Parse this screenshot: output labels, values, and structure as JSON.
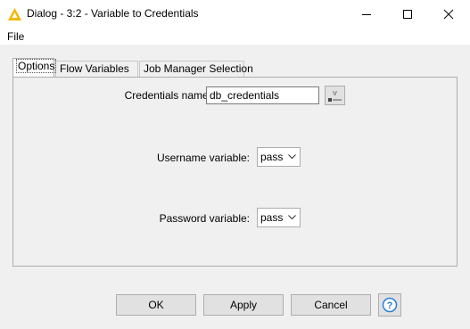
{
  "window": {
    "title": "Dialog - 3:2 - Variable to Credentials",
    "accent_color": "#f5b800"
  },
  "menu": {
    "items": [
      {
        "label": "File"
      }
    ]
  },
  "tabs": [
    {
      "label": "Options",
      "active": true
    },
    {
      "label": "Flow Variables",
      "active": false
    },
    {
      "label": "Job Manager Selection",
      "active": false
    }
  ],
  "form": {
    "credentials_label": "Credentials name:",
    "credentials_value": "db_credentials",
    "username_label": "Username variable:",
    "username_value": "pass",
    "password_label": "Password variable:",
    "password_value": "pass"
  },
  "buttons": {
    "ok": "OK",
    "apply": "Apply",
    "cancel": "Cancel"
  },
  "icons": {
    "app": "warning-triangle-icon",
    "flow_variable": "flow-variable-icon",
    "help": "help-icon",
    "minimize": "minimize-icon",
    "maximize": "maximize-icon",
    "close": "close-icon"
  }
}
